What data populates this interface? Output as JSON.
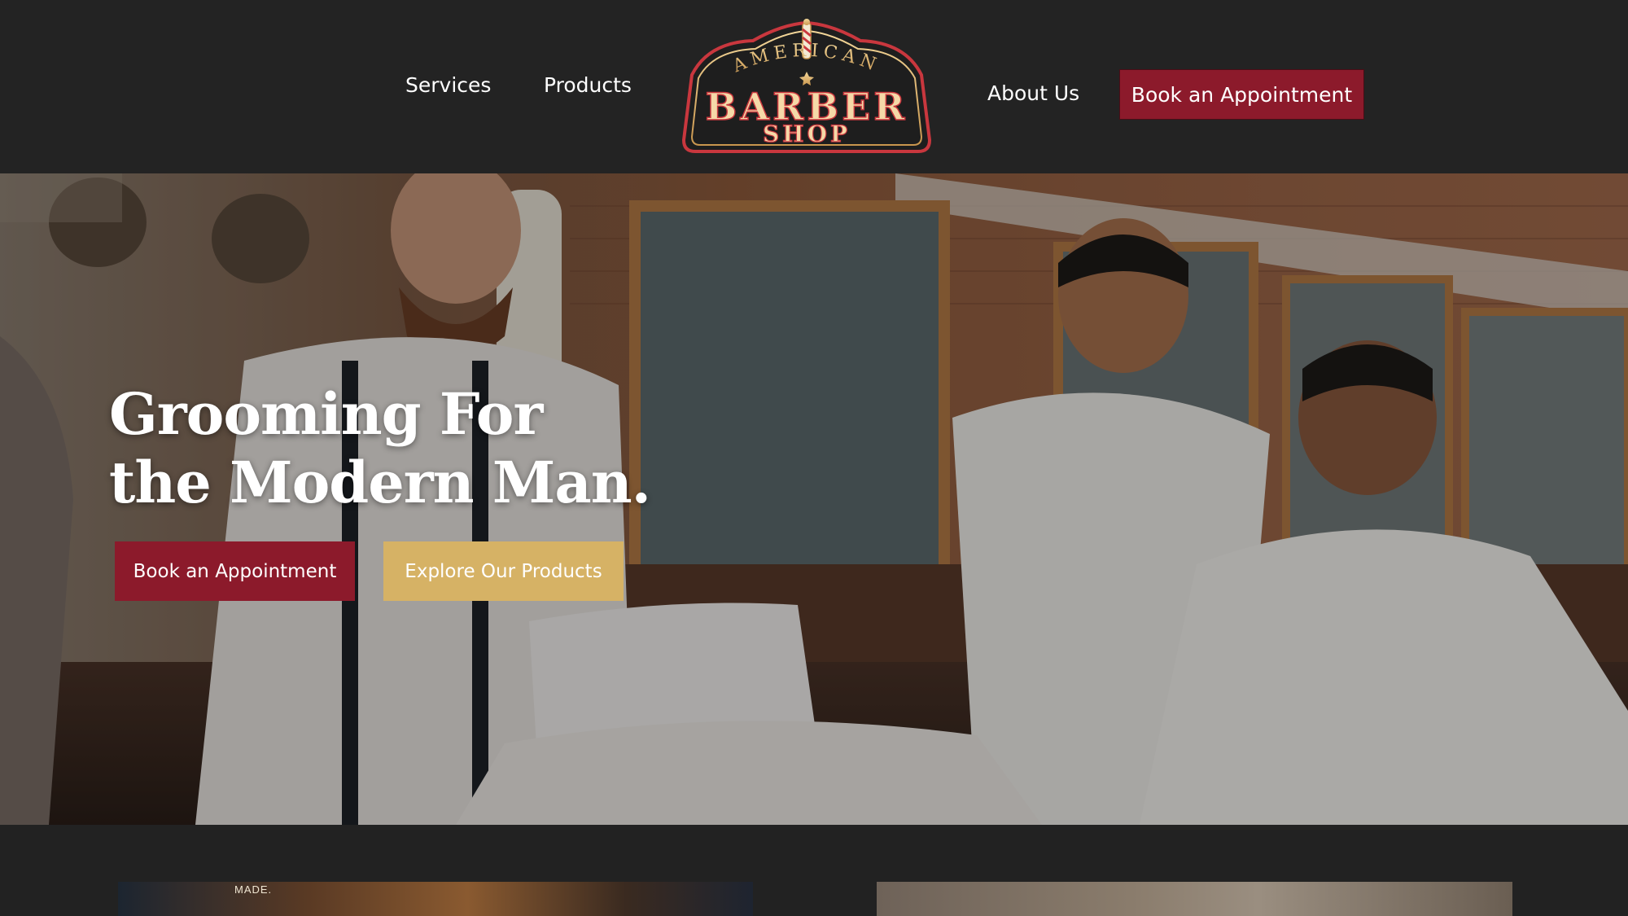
{
  "header": {
    "nav_left": [
      "Services",
      "Products"
    ],
    "nav_right": "About Us",
    "cta_label": "Book an Appointment",
    "logo": {
      "line1": "AMERICAN",
      "line2": "BARBER",
      "line3": "SHOP"
    }
  },
  "hero": {
    "title_line1": "Grooming For",
    "title_line2": "the Modern Man.",
    "primary_button": "Book an Appointment",
    "secondary_button": "Explore Our Products"
  },
  "cards": {
    "left_visible_text": "MADE."
  },
  "colors": {
    "background": "#222222",
    "brand_red": "#8c1a2b",
    "brand_gold": "#d6b265",
    "text": "#ffffff"
  },
  "icons": [
    "barber-pole-icon"
  ]
}
